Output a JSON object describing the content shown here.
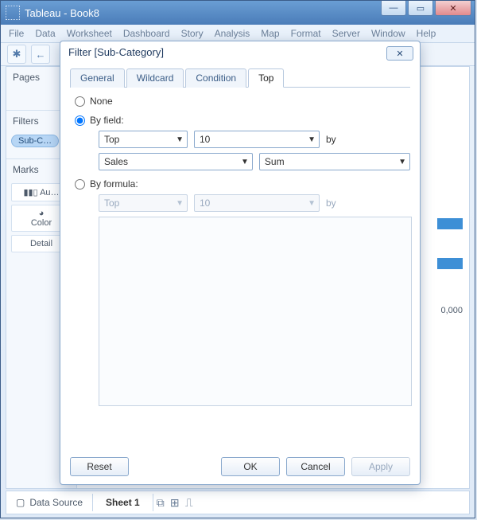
{
  "app": {
    "title": "Tableau - Book8"
  },
  "menu": [
    "File",
    "Data",
    "Worksheet",
    "Dashboard",
    "Story",
    "Analysis",
    "Map",
    "Format",
    "Server",
    "Window",
    "Help"
  ],
  "left": {
    "pages_label": "Pages",
    "filters_label": "Filters",
    "filter_pill": "Sub-C…",
    "marks_label": "Marks",
    "marks_auto": "Au…",
    "card_color": "Color",
    "card_detail": "Detail"
  },
  "axis_tick": "0,000",
  "bottom": {
    "data_source": "Data Source",
    "sheet": "Sheet 1"
  },
  "dialog": {
    "title": "Filter [Sub-Category]",
    "tabs": {
      "general": "General",
      "wildcard": "Wildcard",
      "condition": "Condition",
      "top": "Top"
    },
    "opts": {
      "none": "None",
      "by_field": "By field:",
      "by_formula": "By formula:"
    },
    "by_word": "by",
    "field": {
      "direction": "Top",
      "count": "10",
      "measure": "Sales",
      "agg": "Sum"
    },
    "formula": {
      "direction": "Top",
      "count": "10"
    },
    "buttons": {
      "reset": "Reset",
      "ok": "OK",
      "cancel": "Cancel",
      "apply": "Apply"
    }
  }
}
